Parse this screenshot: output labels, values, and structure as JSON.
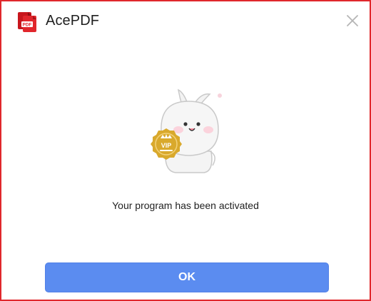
{
  "window": {
    "title": "AcePDF",
    "logo_text": "PDF",
    "border_color": "#e0282c"
  },
  "titlebar": {
    "logo_icon": "acepdf-logo-icon",
    "close_icon": "close-icon"
  },
  "illustration": {
    "icon": "vip-mascot-icon",
    "badge_text": "VIP",
    "badge_color": "#d9a92c"
  },
  "main": {
    "message": "Your program has been activated"
  },
  "actions": {
    "ok_label": "OK",
    "ok_color": "#5b8cf0"
  }
}
